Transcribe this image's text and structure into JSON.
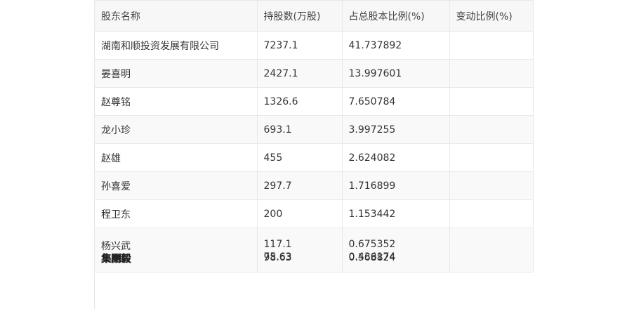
{
  "table": {
    "headers": [
      "股东名称",
      "持股数(万股)",
      "占总股本比例(%)",
      "变动比例(%)"
    ],
    "rows": [
      {
        "name": "湖南和顺投资发展有限公司",
        "shares": "7237.1",
        "ratio": "41.737892",
        "change": ""
      },
      {
        "name": "晏喜明",
        "shares": "2427.1",
        "ratio": "13.997601",
        "change": ""
      },
      {
        "name": "赵尊铭",
        "shares": "1326.6",
        "ratio": "7.650784",
        "change": ""
      },
      {
        "name": "龙小珍",
        "shares": "693.1",
        "ratio": "3.997255",
        "change": ""
      },
      {
        "name": "赵雄",
        "shares": "455",
        "ratio": "2.624082",
        "change": ""
      },
      {
        "name": "孙喜爱",
        "shares": "297.7",
        "ratio": "1.716899",
        "change": ""
      },
      {
        "name": "程卫东",
        "shares": "200",
        "ratio": "1.153442",
        "change": ""
      }
    ],
    "last_row": {
      "name": "杨兴武",
      "shares": "117.1",
      "ratio": "0.675352",
      "overlap_names": [
        "集團毅",
        "集剛毅"
      ],
      "overlap_shares": [
        "75.63",
        "98.63"
      ],
      "overlap_ratios": [
        "0.436174",
        "0.568824"
      ],
      "change": ""
    }
  }
}
